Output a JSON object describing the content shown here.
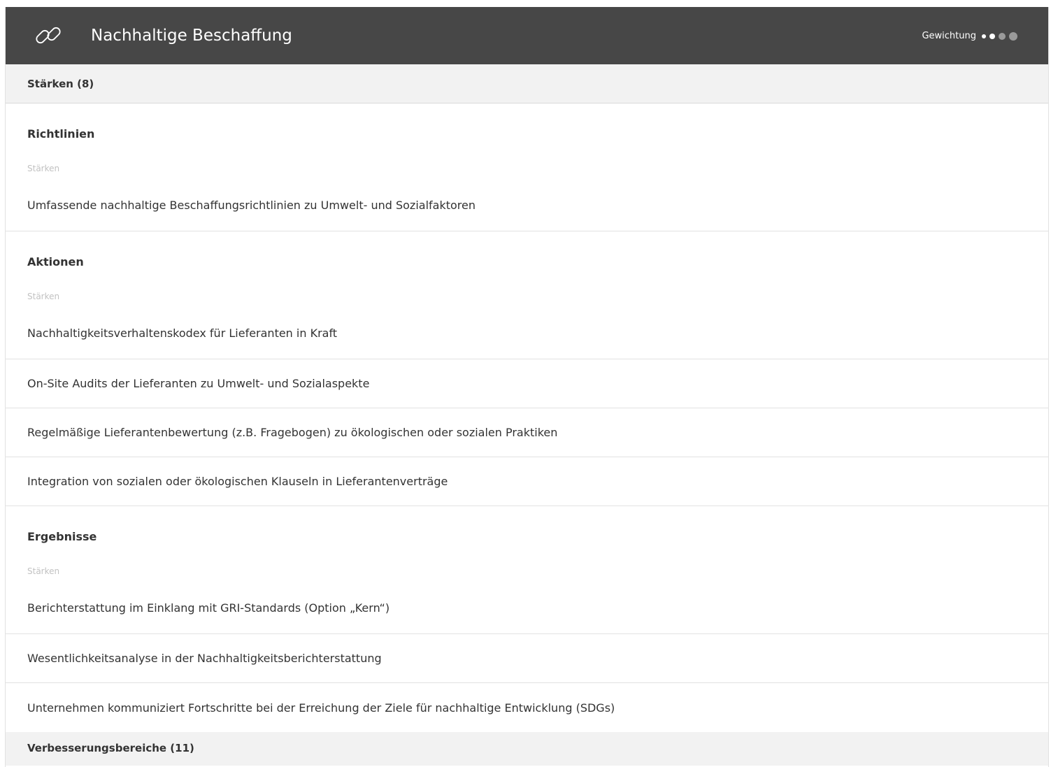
{
  "header": {
    "title": "Nachhaltige Beschaffung",
    "icon": "link-icon",
    "weighting_label": "Gewichtung",
    "weighting_level": 2,
    "weighting_max": 4
  },
  "strengths_section": {
    "label": "Stärken (8)"
  },
  "groups": [
    {
      "title": "Richtlinien",
      "subtitle": "Stärken",
      "items": [
        "Umfassende nachhaltige Beschaffungsrichtlinien zu Umwelt- und Sozialfaktoren"
      ]
    },
    {
      "title": "Aktionen",
      "subtitle": "Stärken",
      "items": [
        "Nachhaltigkeitsverhaltenskodex für Lieferanten in Kraft",
        "On-Site Audits der Lieferanten zu Umwelt- und Sozialaspekte",
        "Regelmäßige Lieferantenbewertung (z.B. Fragebogen) zu ökologischen oder sozialen Praktiken",
        "Integration von sozialen oder ökologischen Klauseln in Lieferantenverträge"
      ]
    },
    {
      "title": "Ergebnisse",
      "subtitle": "Stärken",
      "items": [
        "Berichterstattung im Einklang mit GRI-Standards (Option „Kern“)",
        "Wesentlichkeitsanalyse in der Nachhaltigkeitsberichterstattung",
        "Unternehmen kommuniziert Fortschritte bei der Erreichung der Ziele für nachhaltige Entwicklung (SDGs)"
      ]
    }
  ],
  "improvements_section": {
    "label": "Verbesserungsbereiche (11)"
  },
  "colors": {
    "header_bg": "#474747",
    "section_bg": "#f2f2f2",
    "dot_active": "#ffffff",
    "dot_inactive": "#9a9a9a"
  }
}
